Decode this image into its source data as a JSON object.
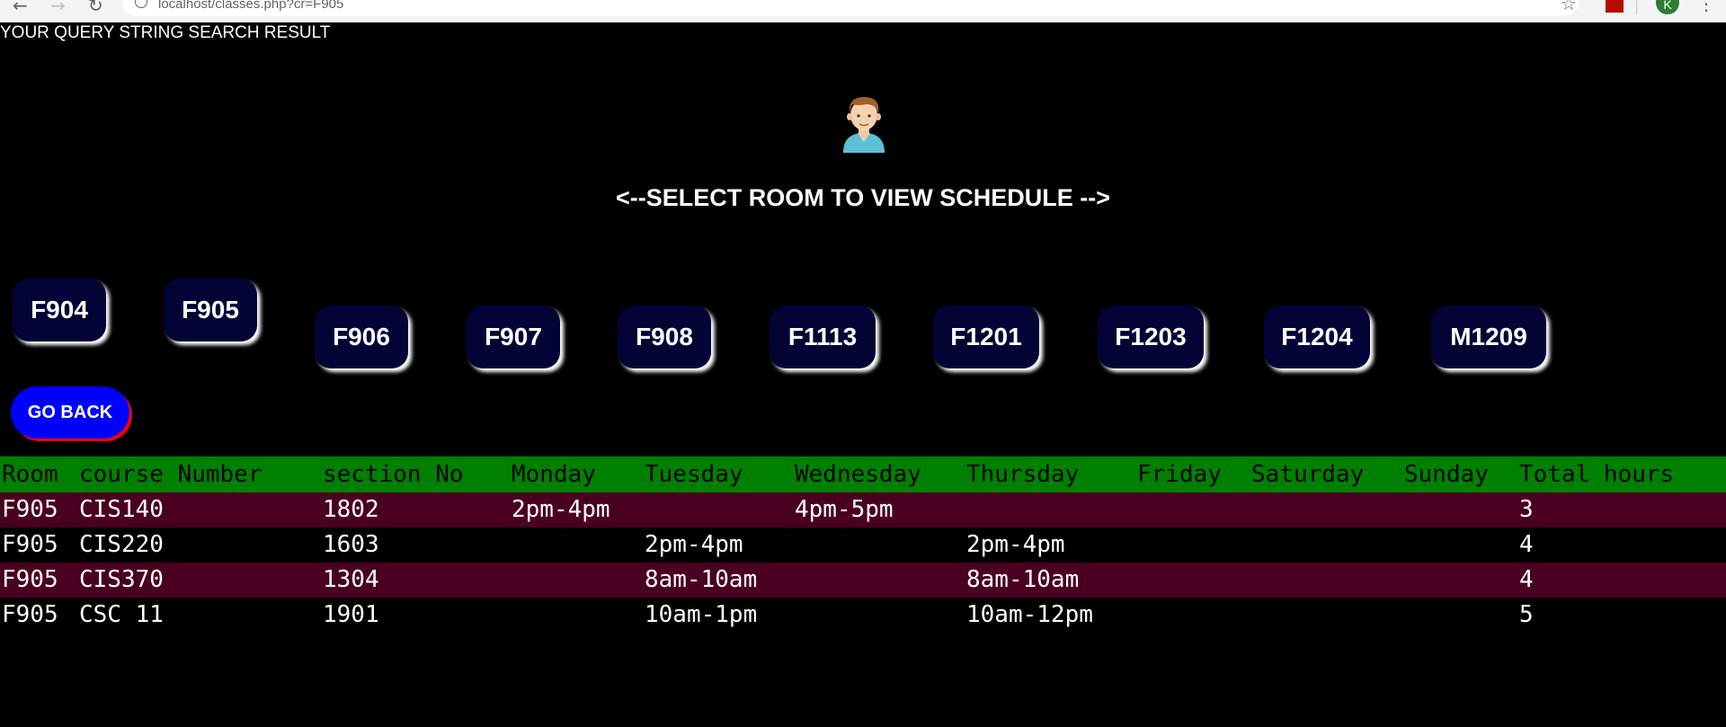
{
  "browser": {
    "url": "localhost/classes.php?cr=F905",
    "back_icon": "←",
    "forward_icon": "→",
    "reload_icon": "↻",
    "star_icon": "☆",
    "profile_initial": "K",
    "menu_icon": "⋮"
  },
  "page": {
    "query_result": "YOUR QUERY STRING SEARCH RESULT",
    "heading": "<--SELECT ROOM TO VIEW SCHEDULE -->",
    "go_back": "GO BACK"
  },
  "rooms": [
    "F904",
    "F905",
    "F906",
    "F907",
    "F908",
    "F1113",
    "F1201",
    "F1203",
    "F1204",
    "M1209"
  ],
  "table": {
    "headers": [
      "Room",
      "course Number",
      "section No",
      "Monday",
      "Tuesday",
      "Wednesday",
      "Thursday",
      "Friday",
      "Saturday",
      "Sunday",
      "Total hours"
    ],
    "rows": [
      [
        "F905",
        "CIS140",
        "1802",
        "2pm-4pm",
        "",
        "4pm-5pm",
        "",
        "",
        "",
        "",
        "3"
      ],
      [
        "F905",
        "CIS220",
        "1603",
        "",
        "2pm-4pm",
        "",
        "2pm-4pm",
        "",
        "",
        "",
        "4"
      ],
      [
        "F905",
        "CIS370",
        "1304",
        "",
        "8am-10am",
        "",
        "8am-10am",
        "",
        "",
        "",
        "4"
      ],
      [
        "F905",
        "CSC 11",
        "1901",
        "",
        "10am-1pm",
        "",
        "10am-12pm",
        "",
        "",
        "",
        "5"
      ]
    ]
  },
  "colors": {
    "background": "#000000",
    "room_button": "#030336",
    "go_back": "#0000ff",
    "header_row": "#008000",
    "odd_row": "#4a0020"
  }
}
